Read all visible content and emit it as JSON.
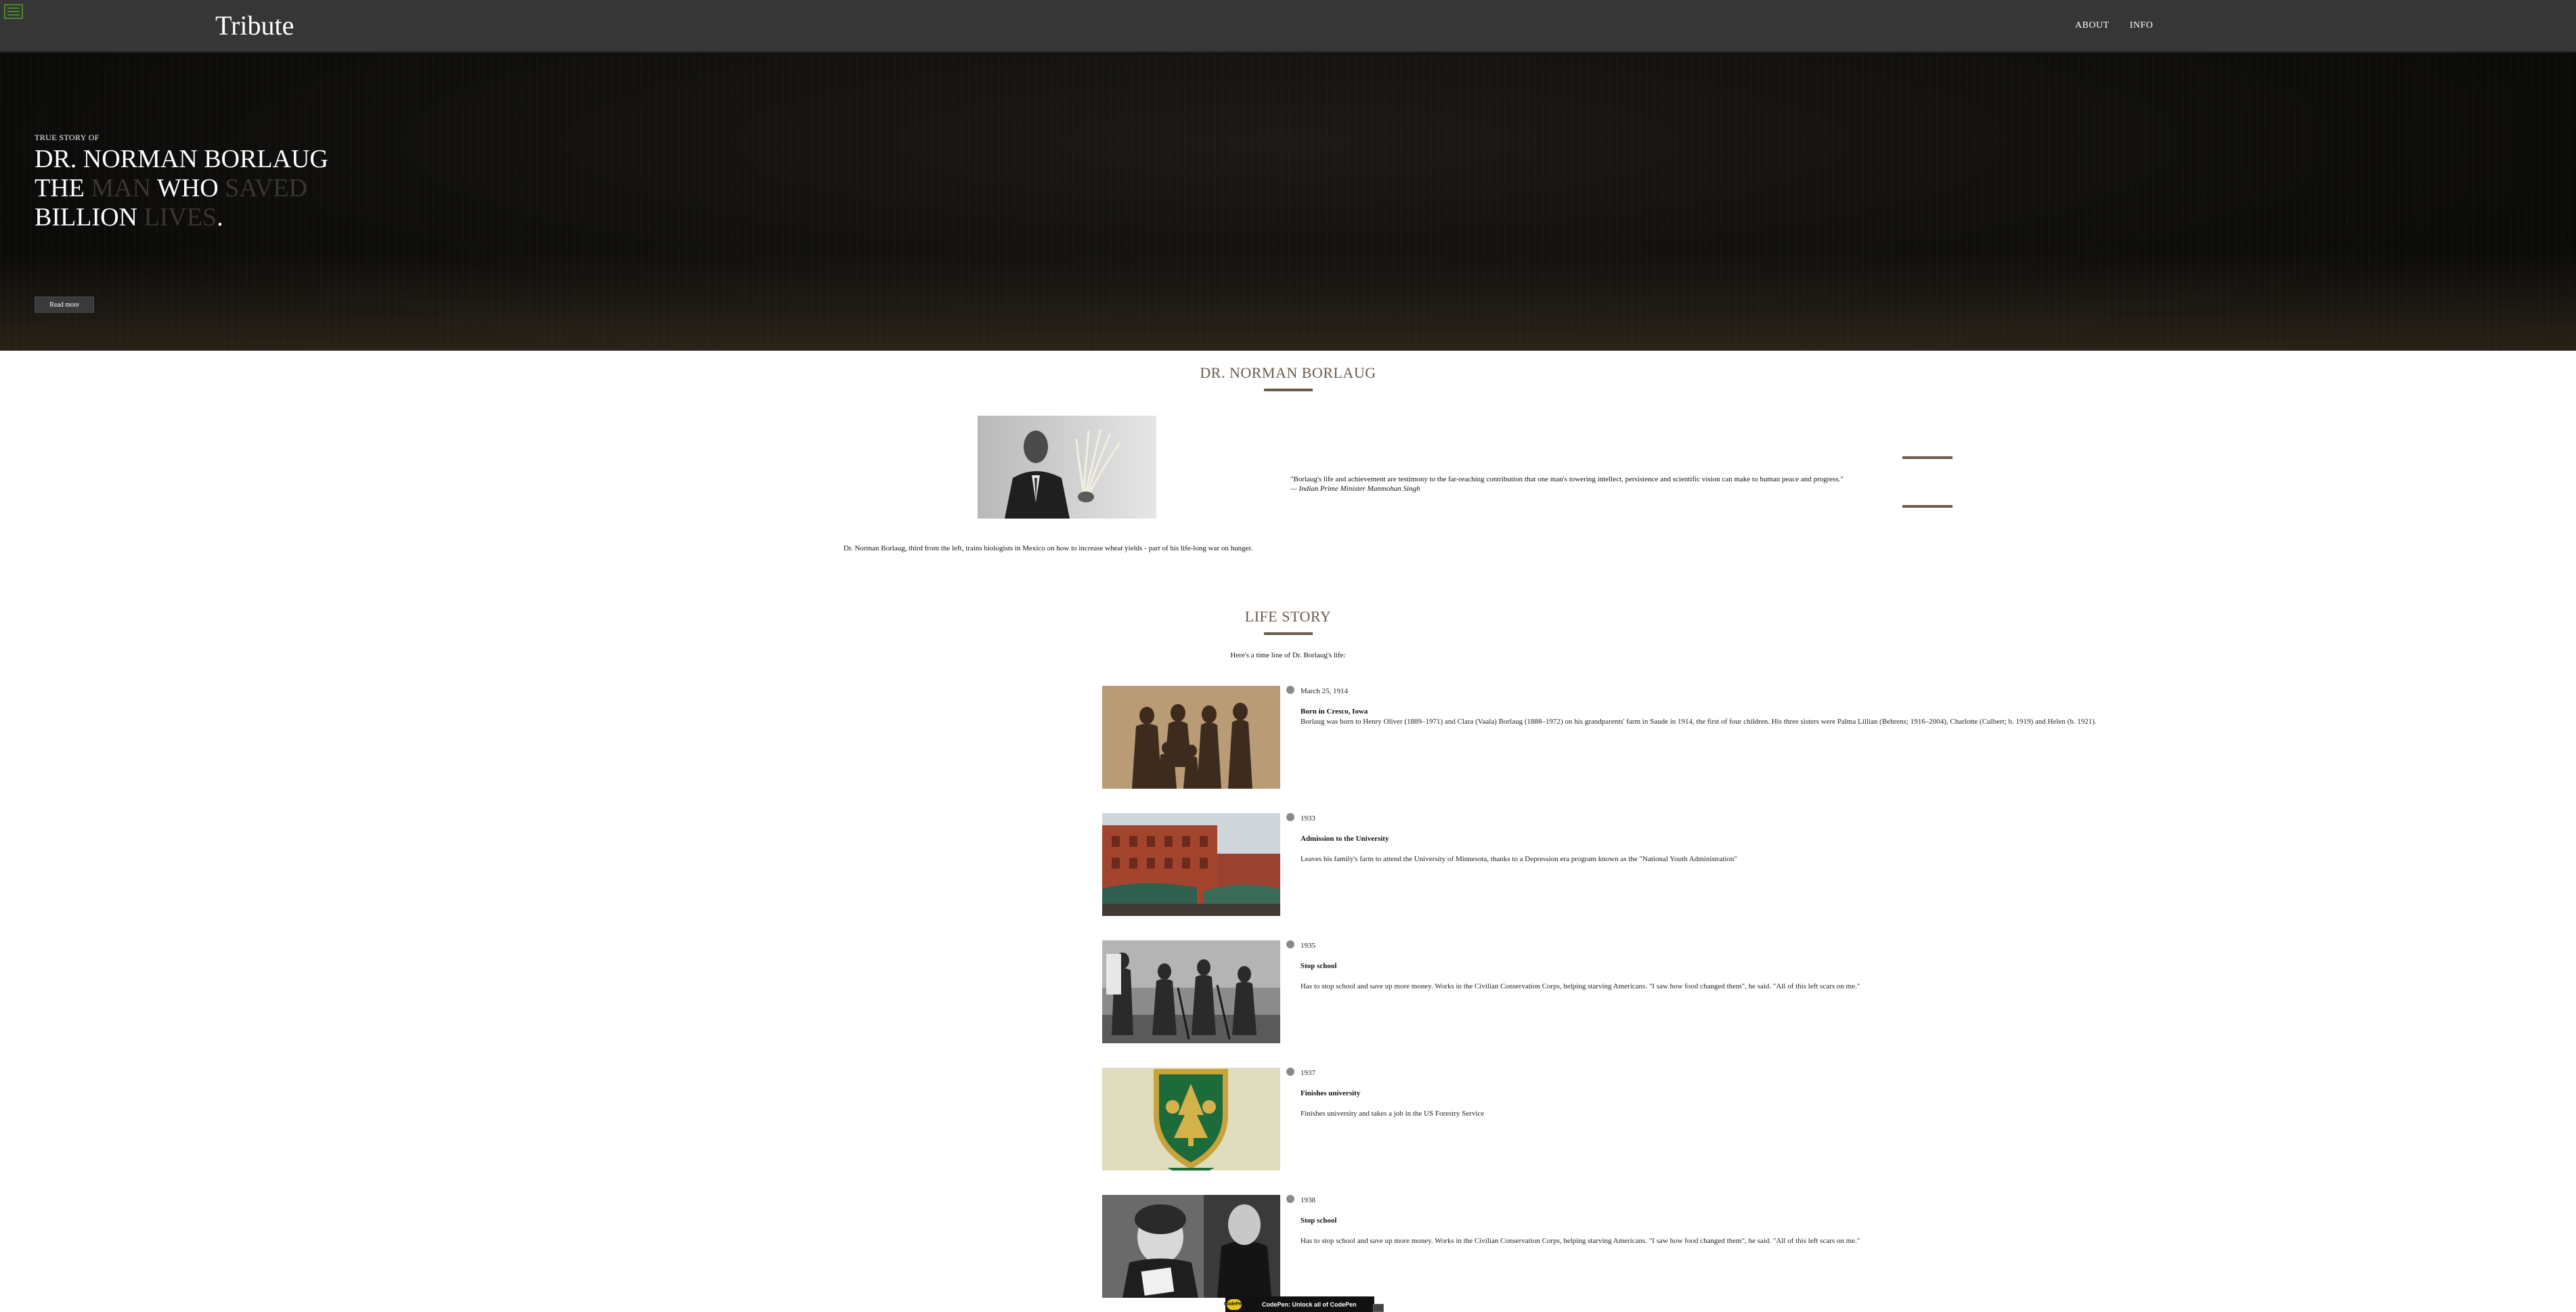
{
  "header": {
    "brand": "Tribute",
    "nav": [
      {
        "label": "ABOUT"
      },
      {
        "label": "INFO"
      }
    ]
  },
  "hero": {
    "kicker": "TRUE STORY OF",
    "line1": "DR. NORMAN BORLAUG",
    "line2": {
      "w1": "THE",
      "w2": "MAN",
      "w3": "WHO",
      "w4": "SAVED"
    },
    "line3": {
      "w1": "BILLION",
      "w2": "LIVES",
      "w3": "."
    },
    "button_label": "Read more"
  },
  "about": {
    "title": "DR. NORMAN BORLAUG",
    "quote": "\"Borlaug's life and achievement are testimony to the far-reaching contribution that one man's towering intellect, persistence and scientific vision can make to human peace and progress.\"",
    "quote_author": "— Indian Prime Minister Manmohan Singh",
    "caption": "Dr. Norman Borlaug, third from the left, trains biologists in Mexico on how to increase wheat yields - part of his life-long war on hunger."
  },
  "life": {
    "title": "LIFE STORY",
    "intro": "Here's a time line of Dr. Borlaug's life:",
    "items": [
      {
        "date": "March 25, 1914",
        "title": "Born in Cresco, Iowa",
        "description": "Borlaug was born to Henry Oliver (1889–1971) and Clara (Vaala) Borlaug (1888–1972) on his grandparents' farm in Saude in 1914, the first of four children. His three sisters were Palma Lillian (Behrens; 1916–2004), Charlotte (Culbert; b. 1919) and Helen (b. 1921)."
      },
      {
        "date": "1933",
        "title": "Admission to the University",
        "description": "Leaves his family's farm to attend the University of Minnesota, thanks to a Depression era program known as the \"National Youth Administration\""
      },
      {
        "date": "1935",
        "title": "Stop school",
        "description": "Has to stop school and save up more money. Works in the Civilian Conservation Corps, helping starving Americans. \"I saw how food changed them\", he said. \"All of this left scars on me.\""
      },
      {
        "date": "1937",
        "title": "Finishes university",
        "description": "Finishes university and takes a job in the US Forestry Service"
      },
      {
        "date": "1938",
        "title": "Stop school",
        "description": "Has to stop school and save up more money. Works in the Civilian Conservation Corps, helping starving Americans. \"I saw how food changed them\", he said. \"All of this left scars on me.\""
      }
    ]
  },
  "badge": {
    "logo_text": "CodePen",
    "text": "CodePen: Unlock all of CodePen"
  }
}
